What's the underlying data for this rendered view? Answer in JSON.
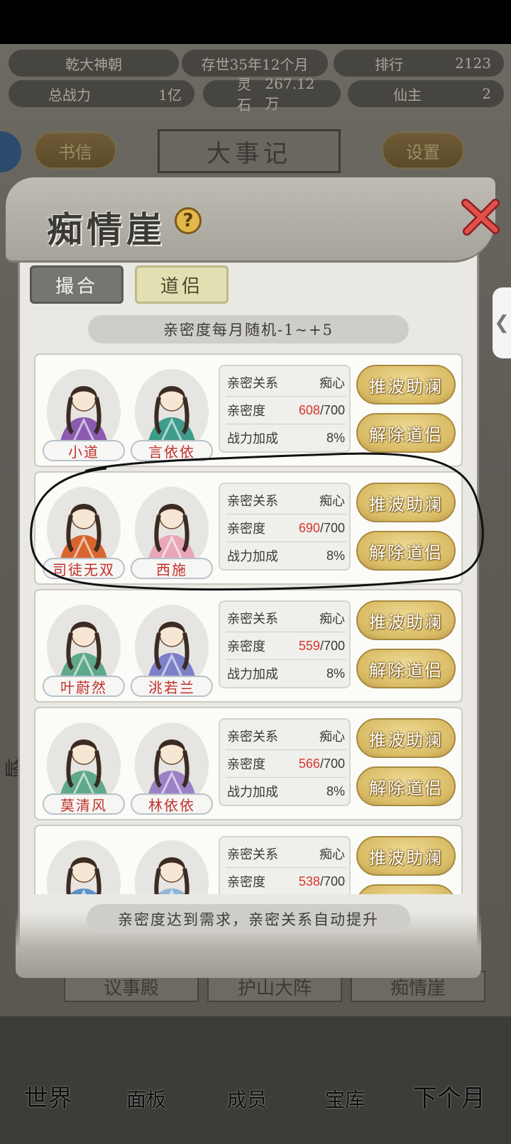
{
  "hud": {
    "dynasty": "乾大神朝",
    "age": "存世35年12个月",
    "rank_label": "排行",
    "rank_value": "2123",
    "power_label": "总战力",
    "power_value": "1亿",
    "stone_label": "灵石",
    "stone_value": "267.12万",
    "immortal_label": "仙主",
    "immortal_value": "2"
  },
  "bg_nav": {
    "letters": "书信",
    "event_title": "大事记",
    "settings": "设置",
    "tabs": [
      "议事殿",
      "护山大阵",
      "痴情崖"
    ],
    "bottom": [
      "世界",
      "面板",
      "成员",
      "宝库",
      "下个月"
    ],
    "side_char": "峰"
  },
  "modal": {
    "title": "痴情崖",
    "help": "?",
    "tabs": {
      "matchmake": "撮合",
      "partner": "道侣"
    },
    "banner": "亲密度每月随机-1~+5",
    "footer": "亲密度达到需求，亲密关系自动提升",
    "labels": {
      "relation": "亲密关系",
      "intimacy": "亲密度",
      "bonus": "战力加成",
      "help_btn": "推波助澜",
      "dissolve_btn": "解除道侣"
    },
    "pairs": [
      {
        "left_name": "小道",
        "right_name": "言依依",
        "relation": "痴心",
        "intimacy": "608",
        "max": "/700",
        "bonus": "8%",
        "left_color": "#8a5bb0",
        "right_color": "#3e9c8a"
      },
      {
        "left_name": "司徒无双",
        "right_name": "西施",
        "relation": "痴心",
        "intimacy": "690",
        "max": "/700",
        "bonus": "8%",
        "left_color": "#d9652e",
        "right_color": "#e8a7b8"
      },
      {
        "left_name": "叶蔚然",
        "right_name": "洮若兰",
        "relation": "痴心",
        "intimacy": "559",
        "max": "/700",
        "bonus": "8%",
        "left_color": "#5fa88a",
        "right_color": "#7d7fc8"
      },
      {
        "left_name": "莫清风",
        "right_name": "林依依",
        "relation": "痴心",
        "intimacy": "566",
        "max": "/700",
        "bonus": "8%",
        "left_color": "#5fa88a",
        "right_color": "#9c80c6"
      },
      {
        "left_name": "",
        "right_name": "",
        "relation": "痴心",
        "intimacy": "538",
        "max": "/700",
        "bonus": "",
        "left_color": "#5d8fc6",
        "right_color": "#8fb5d8"
      }
    ]
  }
}
